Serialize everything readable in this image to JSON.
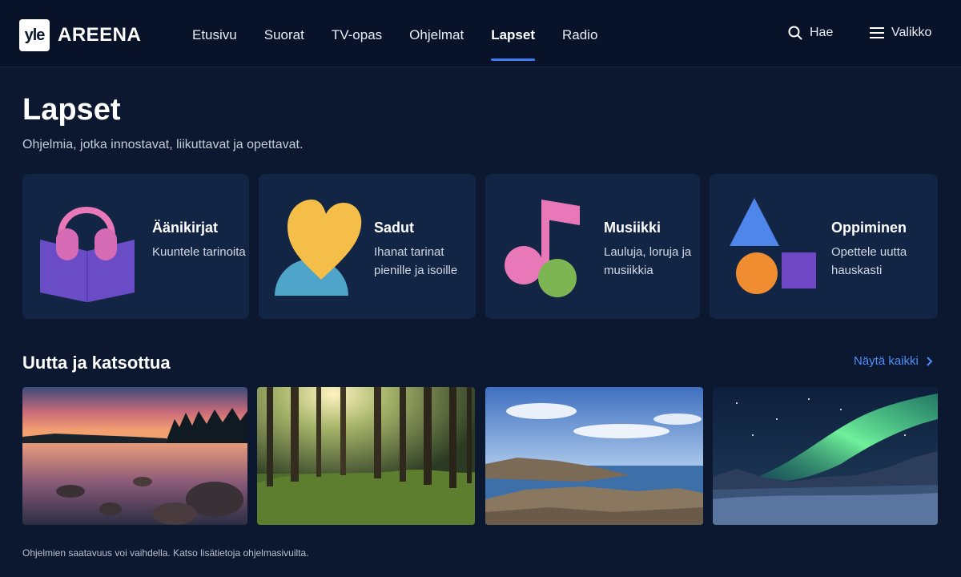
{
  "header": {
    "logo_badge": "yle",
    "logo_text": "AREENA",
    "nav": [
      {
        "label": "Etusivu",
        "active": false
      },
      {
        "label": "Suorat",
        "active": false
      },
      {
        "label": "TV-opas",
        "active": false
      },
      {
        "label": "Ohjelmat",
        "active": false
      },
      {
        "label": "Lapset",
        "active": true
      },
      {
        "label": "Radio",
        "active": false
      }
    ],
    "search_label": "Hae",
    "menu_label": "Valikko"
  },
  "page": {
    "title": "Lapset",
    "subtitle": "Ohjelmia, jotka innostavat, liikuttavat ja opettavat."
  },
  "categories": [
    {
      "name": "Äänikirjat",
      "description": "Kuuntele tarinoita",
      "icon": "headphones-book-icon"
    },
    {
      "name": "Sadut",
      "description": "Ihanat tarinat pienille ja isoille",
      "icon": "heart-icon"
    },
    {
      "name": "Musiikki",
      "description": "Lauluja, loruja ja musiikkia",
      "icon": "music-note-icon"
    },
    {
      "name": "Oppiminen",
      "description": "Opettele uutta hauskasti",
      "icon": "shapes-icon"
    }
  ],
  "section": {
    "title": "Uutta ja katsottua",
    "show_all_label": "Näytä kaikki",
    "thumbnails": [
      "sunset-lake-image",
      "forest-image",
      "rocky-coast-image",
      "northern-lights-image"
    ]
  },
  "footer": {
    "note": "Ohjelmien saatavuus voi vaihdella. Katso lisätietoja ohjelmasivuilta."
  },
  "colors": {
    "background": "#0b1830",
    "card": "#132544",
    "accent": "#3d7bf0",
    "link": "#4f8ef7"
  }
}
